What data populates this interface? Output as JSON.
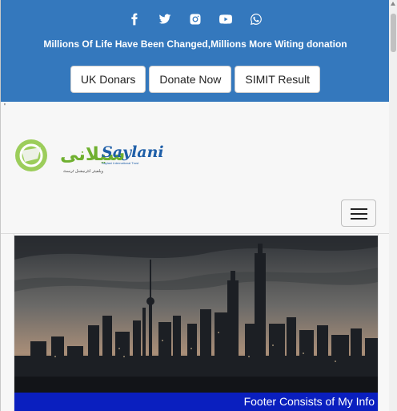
{
  "topbar": {
    "social_icons": [
      "facebook-icon",
      "twitter-icon",
      "instagram-icon",
      "youtube-icon",
      "whatsapp-icon"
    ],
    "tagline": "Millions Of Life Have Been Changed,Millions More Witing donation",
    "buttons": {
      "uk": "UK Donars",
      "donate": "Donate Now",
      "simit": "SIMIT Result"
    },
    "color": "#3478bd"
  },
  "tick_mark": "'",
  "logo": {
    "urdu_text": "سیلانی",
    "brand_text": "Saylani",
    "sub_text": "Saylani International Trust",
    "urdu_sub": "ویلفیئر انٹرنیشنل ٹرسٹ"
  },
  "nav": {
    "menu_icon": "hamburger-icon"
  },
  "hero": {
    "image": "city-skyline-night",
    "footer_text": "Footer Consists of My Info",
    "footer_color": "#0a1fbf"
  }
}
